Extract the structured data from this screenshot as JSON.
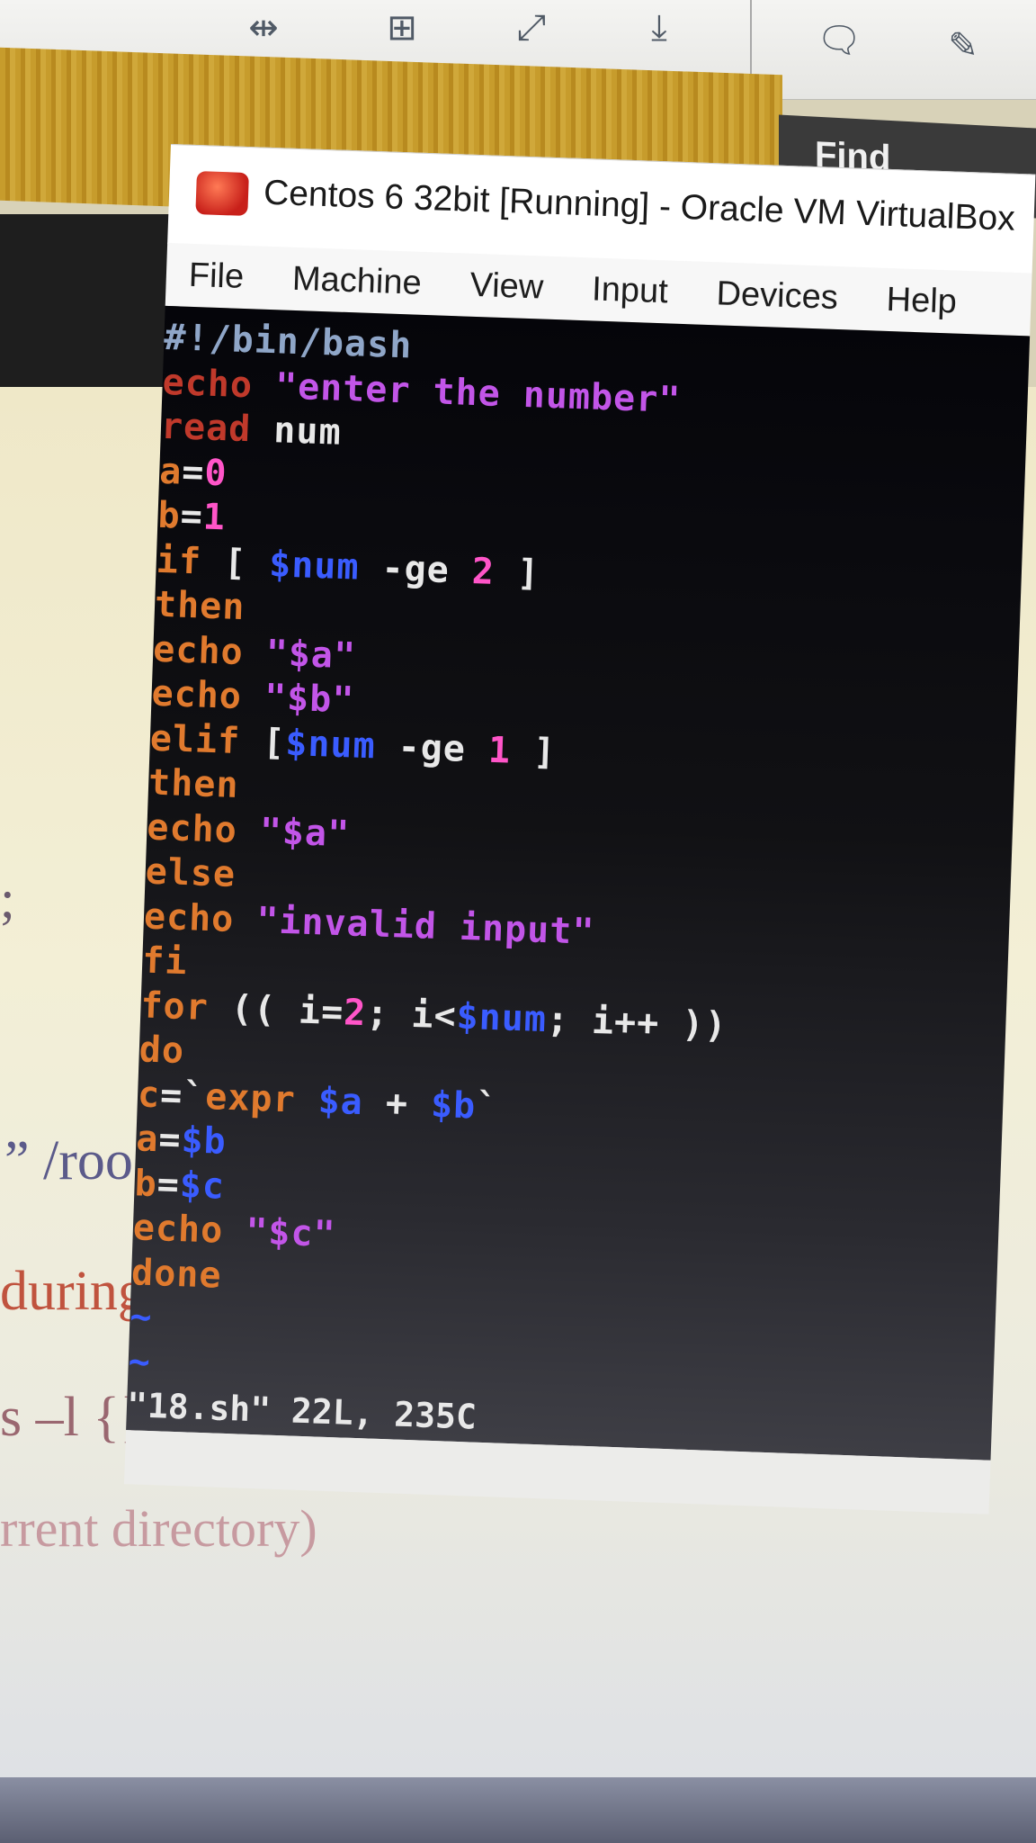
{
  "host": {
    "find_label": "Find",
    "doc_fragments": [
      "” /roo",
      "during",
      "s –l {}",
      "rrent  directory)",
      ";"
    ]
  },
  "toolbar_icons": [
    "fit-width-icon",
    "fit-page-icon",
    "fullscreen-icon",
    "download-icon",
    "comment-icon",
    "highlight-icon"
  ],
  "window": {
    "title": "Centos 6 32bit [Running] - Oracle VM VirtualBox",
    "menu": [
      "File",
      "Machine",
      "View",
      "Input",
      "Devices",
      "Help"
    ]
  },
  "editor": {
    "lines": [
      "#!/bin/bash",
      "echo \"enter the number\"",
      "read num",
      "a=0",
      "b=1",
      "if [ $num -ge 2 ]",
      "then",
      "echo \"$a\"",
      "echo \"$b\"",
      "elif [$num -ge 1 ]",
      "then",
      "echo \"$a\"",
      "else",
      "echo \"invalid input\"",
      "fi",
      "for (( i=2; i<$num; i++ ))",
      "do",
      "c=`expr $a + $b`",
      "a=$b",
      "b=$c",
      "echo \"$c\"",
      "done",
      "~",
      "~"
    ],
    "status": "\"18.sh\" 22L, 235C"
  },
  "colors": {
    "keyword": "#e07a2e",
    "string": "#c255e8",
    "variable": "#3a5cff",
    "number": "#ff55c8"
  }
}
